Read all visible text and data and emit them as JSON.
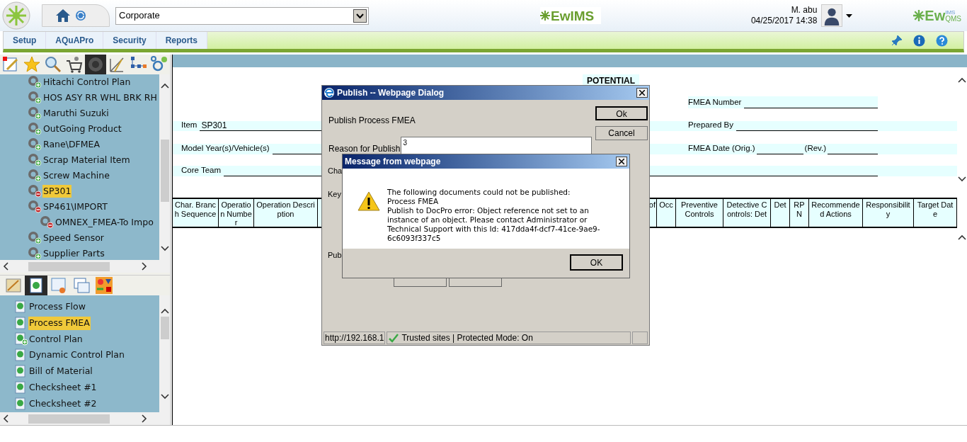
{
  "header": {
    "company_select": {
      "value": "Corporate"
    },
    "app_logo": "EwIMS",
    "brand_logo_main": "Ew",
    "brand_logo_sup": "IMS",
    "brand_logo_sub": "QMS",
    "user": {
      "name": "M. abu",
      "datetime": "04/25/2017 14:38"
    }
  },
  "menu": [
    {
      "label": "Setup"
    },
    {
      "label": "AQuAPro"
    },
    {
      "label": "Security"
    },
    {
      "label": "Reports"
    }
  ],
  "sidebar": {
    "toolbar": [
      {
        "kind": "edit",
        "selected": false
      },
      {
        "kind": "star",
        "selected": false
      },
      {
        "kind": "search",
        "selected": false
      },
      {
        "kind": "cart",
        "selected": false
      },
      {
        "kind": "gear",
        "selected": true
      },
      {
        "kind": "compass",
        "selected": false
      },
      {
        "kind": "flow",
        "selected": false
      },
      {
        "kind": "circles",
        "selected": false
      }
    ],
    "tree": [
      {
        "label": "Hitachi Control Plan",
        "expanded": false,
        "selected": false
      },
      {
        "label": "HOS ASY RR WHL BRK RH",
        "expanded": false,
        "selected": false
      },
      {
        "label": "Maruthi Suzuki",
        "expanded": false,
        "selected": false
      },
      {
        "label": "OutGoing Product",
        "expanded": false,
        "selected": false
      },
      {
        "label": "Rane\\DFMEA",
        "expanded": false,
        "selected": false
      },
      {
        "label": "Scrap Material Item",
        "expanded": false,
        "selected": false
      },
      {
        "label": "Screw Machine",
        "expanded": false,
        "selected": false
      },
      {
        "label": "SP301",
        "expanded": true,
        "selected": true
      },
      {
        "label": "SP461\\IMPORT",
        "expanded": true,
        "selected": false,
        "children": [
          {
            "label": "OMNEX_FMEA-To Impo",
            "expanded": true,
            "selected": false
          }
        ]
      },
      {
        "label": "Speed Sensor",
        "expanded": false,
        "selected": false
      },
      {
        "label": "Supplier Parts",
        "expanded": false,
        "selected": false
      }
    ],
    "toolbar2": [
      {
        "kind": "drafting",
        "selected": false
      },
      {
        "kind": "document",
        "selected": true
      },
      {
        "kind": "certificate",
        "selected": false
      },
      {
        "kind": "table",
        "selected": false
      },
      {
        "kind": "shapes",
        "selected": false
      }
    ],
    "documents": [
      {
        "label": "Process Flow",
        "selected": false,
        "addable": false
      },
      {
        "label": "Process FMEA",
        "selected": true,
        "addable": false
      },
      {
        "label": "Control Plan",
        "selected": false,
        "addable": true
      },
      {
        "label": "Dynamic Control Plan",
        "selected": false,
        "addable": false
      },
      {
        "label": "Bill of Material",
        "selected": false,
        "addable": false
      },
      {
        "label": "Checksheet #1",
        "selected": false,
        "addable": false
      },
      {
        "label": "Checksheet #2",
        "selected": false,
        "addable": false
      }
    ]
  },
  "form": {
    "title": "POTENTIAL",
    "item_label": "Item",
    "item_value": "SP301",
    "model_label": "Model Year(s)/Vehicle(s)",
    "core_team_label": "Core Team",
    "fmea_number_label": "FMEA Number",
    "prepared_by_label": "Prepared By",
    "fmea_date_label": "FMEA Date (Orig.)",
    "rev_label": "(Rev.)"
  },
  "table": {
    "columns_left": [
      "Char. Branch Sequence",
      "Operation Number",
      "Operation Description"
    ],
    "columns_right": [
      "of",
      "Occ",
      "Preventive Controls",
      "Detective Controls: Det",
      "Det",
      "RPN",
      "Recommended Actions",
      "Responsibility",
      "Target Date"
    ]
  },
  "publish_dialog": {
    "title": "Publish -- Webpage Dialog",
    "heading": "Publish Process FMEA",
    "reason_label": "Reason for Publish",
    "reason_value": "3",
    "partial_labels": [
      "Cha",
      "Key",
      "Pub"
    ],
    "buttons": [
      "Ok",
      "Cancel"
    ],
    "status_url": "http://192.168.1",
    "status_zone": "Trusted sites | Protected Mode: On"
  },
  "message_dialog": {
    "title": "Message from webpage",
    "lines": [
      "The following documents could not be published:",
      "Process FMEA",
      "Publish to DocPro error: Object reference not set to an instance of an object. Please contact Administrator or Technical Support with this Id: 417dda4f-dcf7-41ce-9ae9-6c6093f337c5"
    ],
    "button": "OK"
  }
}
